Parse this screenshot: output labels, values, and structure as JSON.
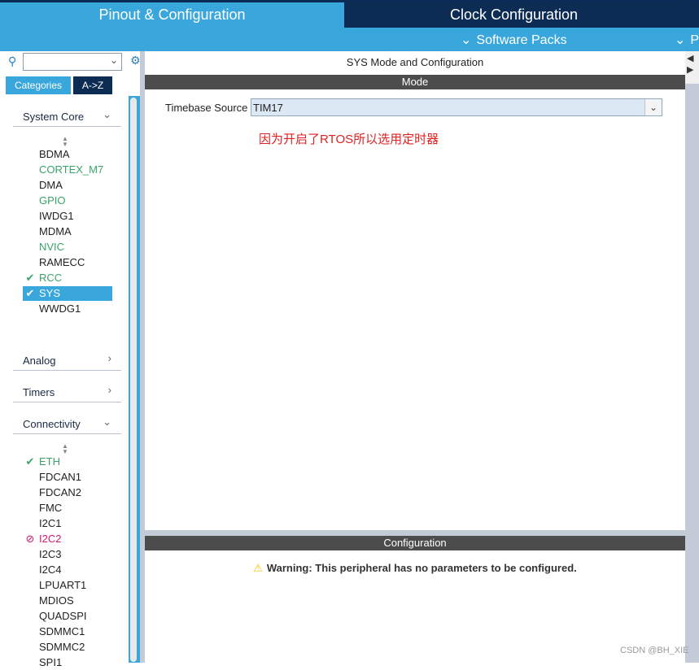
{
  "tabs": {
    "pinout": "Pinout & Configuration",
    "clock": "Clock Configuration"
  },
  "subbar": {
    "software_packs": "Software Packs",
    "p_menu": "P"
  },
  "left": {
    "search": {
      "value": ""
    },
    "view_tabs": {
      "categories": "Categories",
      "atoz": "A->Z"
    },
    "system_core": {
      "label": "System Core",
      "items": [
        {
          "label": "BDMA",
          "status": "none"
        },
        {
          "label": "CORTEX_M7",
          "status": "green"
        },
        {
          "label": "DMA",
          "status": "none"
        },
        {
          "label": "GPIO",
          "status": "green"
        },
        {
          "label": "IWDG1",
          "status": "none"
        },
        {
          "label": "MDMA",
          "status": "none"
        },
        {
          "label": "NVIC",
          "status": "green"
        },
        {
          "label": "RAMECC",
          "status": "none"
        },
        {
          "label": "RCC",
          "status": "check"
        },
        {
          "label": "SYS",
          "status": "selected"
        },
        {
          "label": "WWDG1",
          "status": "none"
        }
      ]
    },
    "analog": {
      "label": "Analog"
    },
    "timers": {
      "label": "Timers"
    },
    "connectivity": {
      "label": "Connectivity",
      "items": [
        {
          "label": "ETH",
          "status": "check"
        },
        {
          "label": "FDCAN1",
          "status": "none"
        },
        {
          "label": "FDCAN2",
          "status": "none"
        },
        {
          "label": "FMC",
          "status": "none"
        },
        {
          "label": "I2C1",
          "status": "none"
        },
        {
          "label": "I2C2",
          "status": "blocked"
        },
        {
          "label": "I2C3",
          "status": "none"
        },
        {
          "label": "I2C4",
          "status": "none"
        },
        {
          "label": "LPUART1",
          "status": "none"
        },
        {
          "label": "MDIOS",
          "status": "none"
        },
        {
          "label": "QUADSPI",
          "status": "none"
        },
        {
          "label": "SDMMC1",
          "status": "none"
        },
        {
          "label": "SDMMC2",
          "status": "none"
        },
        {
          "label": "SPI1",
          "status": "none"
        }
      ]
    }
  },
  "main": {
    "title": "SYS Mode and Configuration",
    "mode_header": "Mode",
    "timebase": {
      "label": "Timebase Source",
      "value": "TIM17"
    },
    "annotation": "因为开启了RTOS所以选用定时器",
    "config_header": "Configuration",
    "warning": "Warning: This peripheral has no parameters to be configured."
  },
  "watermark": "CSDN @BH_XIE",
  "colors": {
    "accent": "#3aa7dc",
    "navy": "#0d2c54",
    "status_green": "#3aa36c",
    "status_pink": "#d1196e",
    "annotation_red": "#e02020"
  }
}
